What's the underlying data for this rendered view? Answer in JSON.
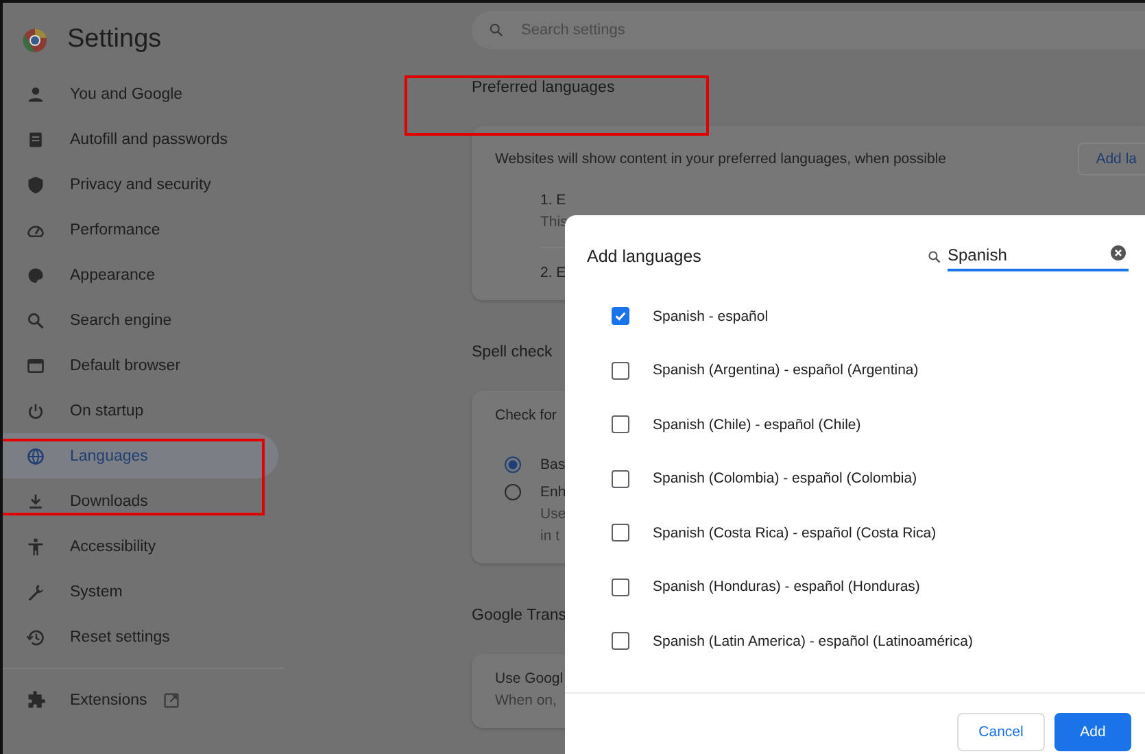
{
  "header": {
    "title": "Settings",
    "search": {
      "placeholder": "Search settings"
    }
  },
  "sidebar": {
    "items": [
      {
        "label": "You and Google",
        "selected": false
      },
      {
        "label": "Autofill and passwords",
        "selected": false
      },
      {
        "label": "Privacy and security",
        "selected": false
      },
      {
        "label": "Performance",
        "selected": false
      },
      {
        "label": "Appearance",
        "selected": false
      },
      {
        "label": "Search engine",
        "selected": false
      },
      {
        "label": "Default browser",
        "selected": false
      },
      {
        "label": "On startup",
        "selected": false
      },
      {
        "label": "Languages",
        "selected": true
      },
      {
        "label": "Downloads",
        "selected": false
      },
      {
        "label": "Accessibility",
        "selected": false
      },
      {
        "label": "System",
        "selected": false
      },
      {
        "label": "Reset settings",
        "selected": false
      }
    ],
    "footer_item": {
      "label": "Extensions"
    }
  },
  "preferred_languages": {
    "heading": "Preferred languages",
    "description": "Websites will show content in your preferred languages, when possible",
    "add_button": "Add la",
    "languages": [
      {
        "name": "1. E",
        "detail": "This"
      },
      {
        "name": "2. E"
      }
    ]
  },
  "spell_check": {
    "heading": "Spell check",
    "description": "Check for",
    "options": [
      {
        "label": "Bas",
        "selected": true
      },
      {
        "label": "Enh",
        "detail": [
          "Use",
          "in t"
        ],
        "selected": false
      }
    ]
  },
  "google_translate": {
    "heading": "Google Trans",
    "title": "Use Googl",
    "description": "When on,"
  },
  "dialog": {
    "title": "Add languages",
    "search": {
      "value": "Spanish"
    },
    "options": [
      {
        "label": "Spanish - español",
        "checked": true
      },
      {
        "label": "Spanish (Argentina) - español (Argentina)",
        "checked": false
      },
      {
        "label": "Spanish (Chile) - español (Chile)",
        "checked": false
      },
      {
        "label": "Spanish (Colombia) - español (Colombia)",
        "checked": false
      },
      {
        "label": "Spanish (Costa Rica) - español (Costa Rica)",
        "checked": false
      },
      {
        "label": "Spanish (Honduras) - español (Honduras)",
        "checked": false
      },
      {
        "label": "Spanish (Latin America) - español (Latinoamérica)",
        "checked": false
      }
    ],
    "buttons": [
      {
        "label": "Cancel",
        "kind": "secondary"
      },
      {
        "label": "Add",
        "kind": "primary"
      }
    ]
  }
}
